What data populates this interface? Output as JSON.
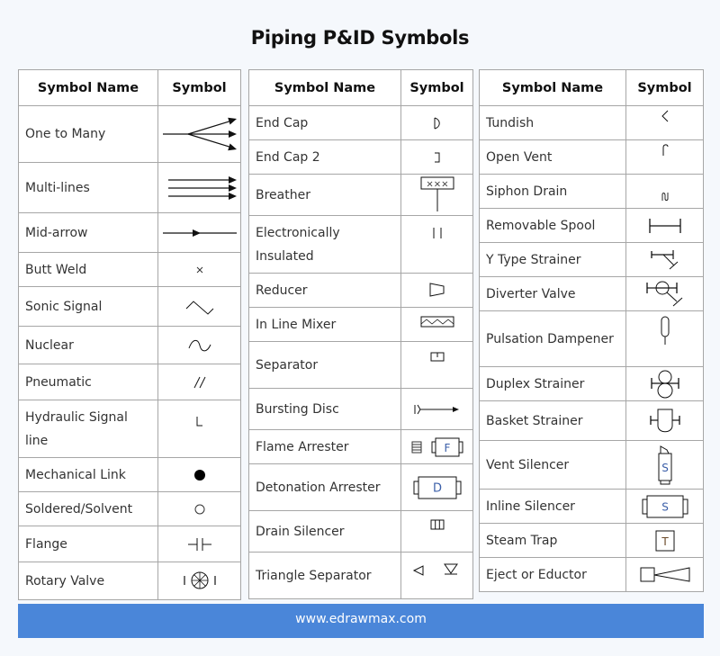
{
  "title": "Piping P&ID Symbols",
  "headers": {
    "name": "Symbol Name",
    "symbol": "Symbol"
  },
  "tables": [
    {
      "rows": [
        {
          "name": "One to Many",
          "icon": "one-to-many"
        },
        {
          "name": "Multi-lines",
          "icon": "multi-lines"
        },
        {
          "name": "Mid-arrow",
          "icon": "mid-arrow"
        },
        {
          "name": "Butt Weld",
          "icon": "butt-weld"
        },
        {
          "name": "Sonic Signal",
          "icon": "sonic-signal"
        },
        {
          "name": "Nuclear",
          "icon": "nuclear"
        },
        {
          "name": "Pneumatic",
          "icon": "pneumatic"
        },
        {
          "name": "Hydraulic Signal line",
          "icon": "hydraulic-signal-line"
        },
        {
          "name": "Mechanical Link",
          "icon": "mechanical-link"
        },
        {
          "name": "Soldered/Solvent",
          "icon": "soldered-solvent"
        },
        {
          "name": "Flange",
          "icon": "flange"
        },
        {
          "name": "Rotary Valve",
          "icon": "rotary-valve"
        }
      ]
    },
    {
      "rows": [
        {
          "name": "End Cap",
          "icon": "end-cap"
        },
        {
          "name": "End Cap 2",
          "icon": "end-cap-2"
        },
        {
          "name": "Breather",
          "icon": "breather",
          "label": "×××"
        },
        {
          "name": "Electronically Insulated",
          "icon": "electronically-insulated"
        },
        {
          "name": "Reducer",
          "icon": "reducer"
        },
        {
          "name": "In Line Mixer",
          "icon": "in-line-mixer"
        },
        {
          "name": "Separator",
          "icon": "separator"
        },
        {
          "name": "Bursting Disc",
          "icon": "bursting-disc"
        },
        {
          "name": "Flame Arrester",
          "icon": "flame-arrester",
          "label": "F"
        },
        {
          "name": "Detonation Arrester",
          "icon": "detonation-arrester",
          "label": "D"
        },
        {
          "name": "Drain Silencer",
          "icon": "drain-silencer"
        },
        {
          "name": "Triangle Separator",
          "icon": "triangle-separator"
        }
      ]
    },
    {
      "rows": [
        {
          "name": "Tundish",
          "icon": "tundish"
        },
        {
          "name": "Open Vent",
          "icon": "open-vent"
        },
        {
          "name": "Siphon Drain",
          "icon": "siphon-drain"
        },
        {
          "name": "Removable Spool",
          "icon": "removable-spool"
        },
        {
          "name": "Y Type Strainer",
          "icon": "y-type-strainer"
        },
        {
          "name": "Diverter Valve",
          "icon": "diverter-valve"
        },
        {
          "name": "Pulsation Dampener",
          "icon": "pulsation-dampener"
        },
        {
          "name": "Duplex Strainer",
          "icon": "duplex-strainer"
        },
        {
          "name": "Basket Strainer",
          "icon": "basket-strainer"
        },
        {
          "name": "Vent Silencer",
          "icon": "vent-silencer",
          "label": "S"
        },
        {
          "name": "Inline Silencer",
          "icon": "inline-silencer",
          "label": "S"
        },
        {
          "name": "Steam Trap",
          "icon": "steam-trap",
          "label": "T"
        },
        {
          "name": "Eject or Eductor",
          "icon": "eject-or-eductor"
        }
      ]
    }
  ],
  "footer": {
    "url": "www.edrawmax.com"
  },
  "colors": {
    "footer_bg": "#4a86d9",
    "border": "#a6a6a6",
    "page_bg": "#f5f8fc"
  }
}
